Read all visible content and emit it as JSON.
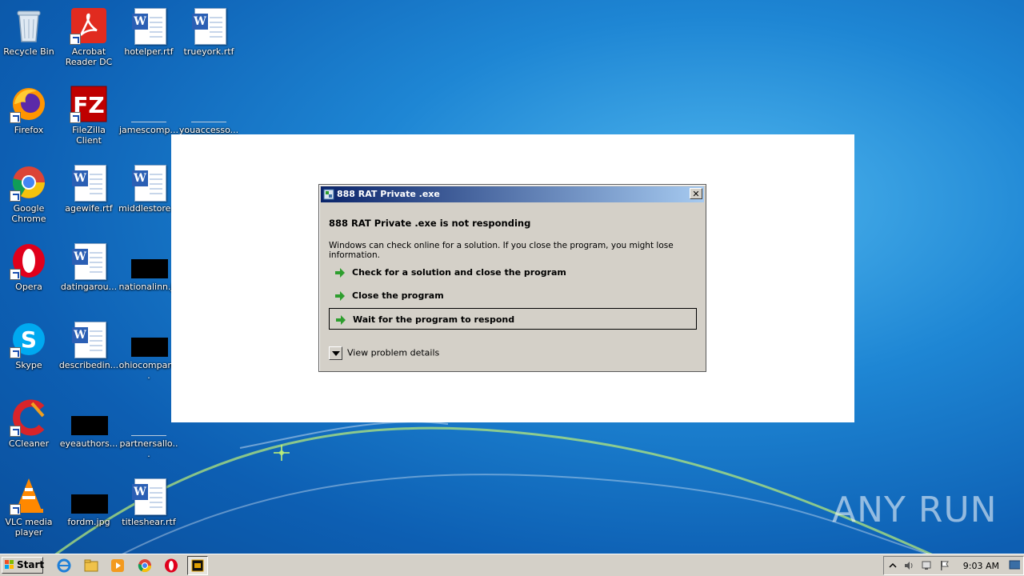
{
  "desktop": {
    "icons": [
      {
        "label": "Recycle Bin"
      },
      {
        "label": "Acrobat Reader DC"
      },
      {
        "label": "hotelper.rtf"
      },
      {
        "label": "trueyork.rtf"
      },
      {
        "label": "Firefox"
      },
      {
        "label": "FileZilla Client"
      },
      {
        "label": "jamescomp..."
      },
      {
        "label": "youaccesso..."
      },
      {
        "label": "Google Chrome"
      },
      {
        "label": "agewife.rtf"
      },
      {
        "label": "middlestore..."
      },
      {
        "label": "Opera"
      },
      {
        "label": "datingarou..."
      },
      {
        "label": "nationalinn.jp"
      },
      {
        "label": "Skype"
      },
      {
        "label": "describedin..."
      },
      {
        "label": "ohiocompan..."
      },
      {
        "label": "CCleaner"
      },
      {
        "label": "eyeauthors..."
      },
      {
        "label": "partnersallo..."
      },
      {
        "label": "VLC media player"
      },
      {
        "label": "fordm.jpg"
      },
      {
        "label": "titleshear.rtf"
      }
    ]
  },
  "dialog": {
    "title": "888 RAT Private .exe",
    "close_glyph": "✕",
    "heading": "888 RAT Private .exe is not responding",
    "description": "Windows can check online for a solution. If you close the program, you might lose information.",
    "options": [
      {
        "label": "Check for a solution and close the program"
      },
      {
        "label": "Close the program"
      },
      {
        "label": "Wait for the program to respond"
      }
    ],
    "details_label": "View problem details"
  },
  "taskbar": {
    "start_label": "Start",
    "clock": "9:03 AM"
  },
  "watermark": "ANY RUN",
  "colors": {
    "accent": "#0a246a",
    "dialog_bg": "#d4d0c8",
    "arrow_green": "#2e9e2e"
  }
}
